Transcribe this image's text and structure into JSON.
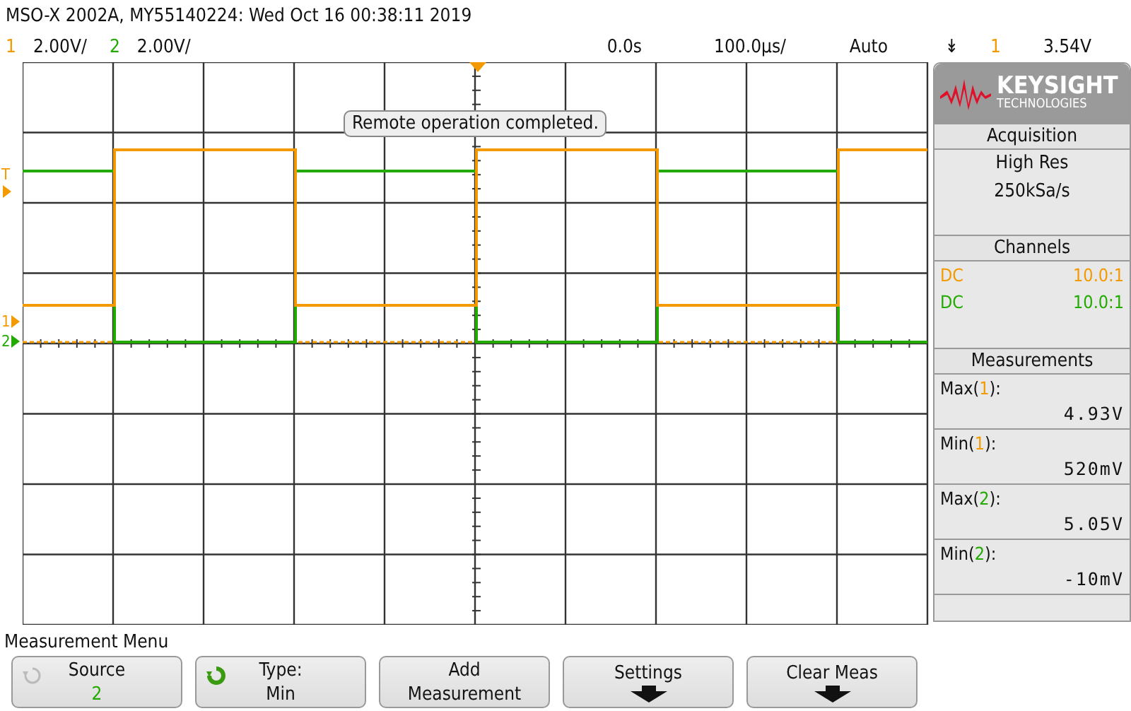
{
  "header": {
    "title": "MSO-X 2002A, MY55140224: Wed Oct 16 00:38:11 2019",
    "channels": [
      {
        "number": "1",
        "scale": "2.00V/",
        "color": "#f39a00"
      },
      {
        "number": "2",
        "scale": "2.00V/",
        "color": "#22aa00"
      }
    ],
    "time_offset": "0.0s",
    "time_scale": "100.0µs/",
    "trigger_mode": "Auto",
    "trigger_slope": "↡",
    "trigger_source": {
      "label": "1",
      "color": "#f39a00"
    },
    "trigger_level": "3.54V"
  },
  "display": {
    "markers": [
      {
        "kind": "trigger",
        "label": "T",
        "color": "#f39a00"
      },
      {
        "kind": "channel",
        "label": "1",
        "color": "#f39a00"
      },
      {
        "kind": "channel",
        "label": "2",
        "color": "#22aa00"
      }
    ],
    "message": "Remote operation completed."
  },
  "panel": {
    "logo": {
      "name": "KEYSIGHT",
      "subtitle": "TECHNOLOGIES"
    },
    "acquisition": {
      "title": "Acquisition",
      "mode": "High Res",
      "rate": "250kSa/s"
    },
    "channels": {
      "title": "Channels",
      "rows": [
        {
          "coupling": "DC",
          "probe": "10.0:1",
          "color": "#f39a00"
        },
        {
          "coupling": "DC",
          "probe": "10.0:1",
          "color": "#22aa00"
        }
      ]
    },
    "measurements": {
      "title": "Measurements",
      "rows": [
        {
          "name": "Max(",
          "source": "1",
          "close": "):",
          "color": "#f39a00",
          "value": "4.93V"
        },
        {
          "name": "Min(",
          "source": "1",
          "close": "):",
          "color": "#f39a00",
          "value": "520mV"
        },
        {
          "name": "Max(",
          "source": "2",
          "close": "):",
          "color": "#22aa00",
          "value": "5.05V"
        },
        {
          "name": "Min(",
          "source": "2",
          "close": "):",
          "color": "#22aa00",
          "value": "-10mV"
        }
      ]
    }
  },
  "menu": {
    "title": "Measurement Menu",
    "softkeys": [
      {
        "kind": "knob",
        "label": "Source",
        "value": {
          "text": "2",
          "color": "#22aa00"
        },
        "knob_active": false
      },
      {
        "kind": "knob",
        "label": "Type:",
        "value": {
          "text": "Min"
        },
        "knob_active": true
      },
      {
        "kind": "text",
        "label": "Add",
        "value": "Measurement"
      },
      {
        "kind": "submenu",
        "label": "Settings"
      },
      {
        "kind": "submenu",
        "label": "Clear Meas"
      }
    ]
  }
}
